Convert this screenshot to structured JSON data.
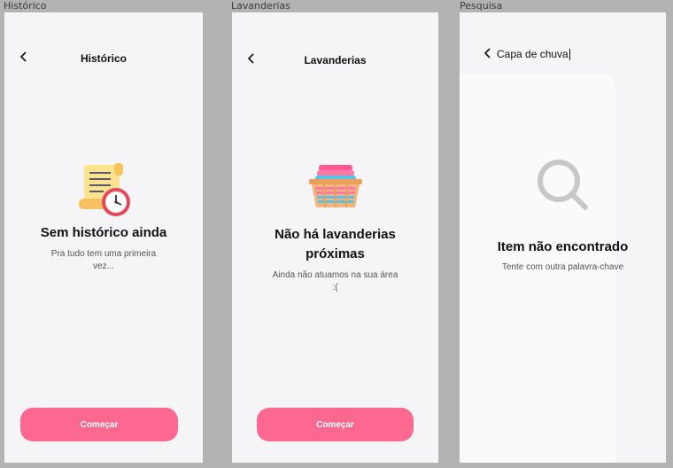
{
  "frames": {
    "historico": {
      "frame_label": "Histórico",
      "title": "Histórico",
      "back_icon": "chevron-left-icon",
      "empty_title": "Sem histórico ainda",
      "empty_sub": "Pra tudo tem uma primeira vez...",
      "cta_label": "Começar",
      "illustration": "scroll-clock-icon"
    },
    "lavanderias": {
      "frame_label": "Lavanderias",
      "title": "Lavanderias",
      "back_icon": "chevron-left-icon",
      "empty_title": "Não há lavanderias próximas",
      "empty_sub": "Ainda não atuamos na sua área :(",
      "cta_label": "Começar",
      "illustration": "laundry-basket-icon"
    },
    "pesquisa": {
      "frame_label": "Pesquisa",
      "search_value": "Capa de chuva",
      "back_icon": "chevron-left-icon",
      "empty_title": "Item não encontrado",
      "empty_sub": "Tente com outra palavra-chave",
      "illustration": "search-icon"
    }
  },
  "colors": {
    "canvas": "#b3b3b3",
    "frame_bg": "#f5f4f6",
    "accent": "#fd6891",
    "text_primary": "#111111",
    "text_secondary": "#555555"
  }
}
